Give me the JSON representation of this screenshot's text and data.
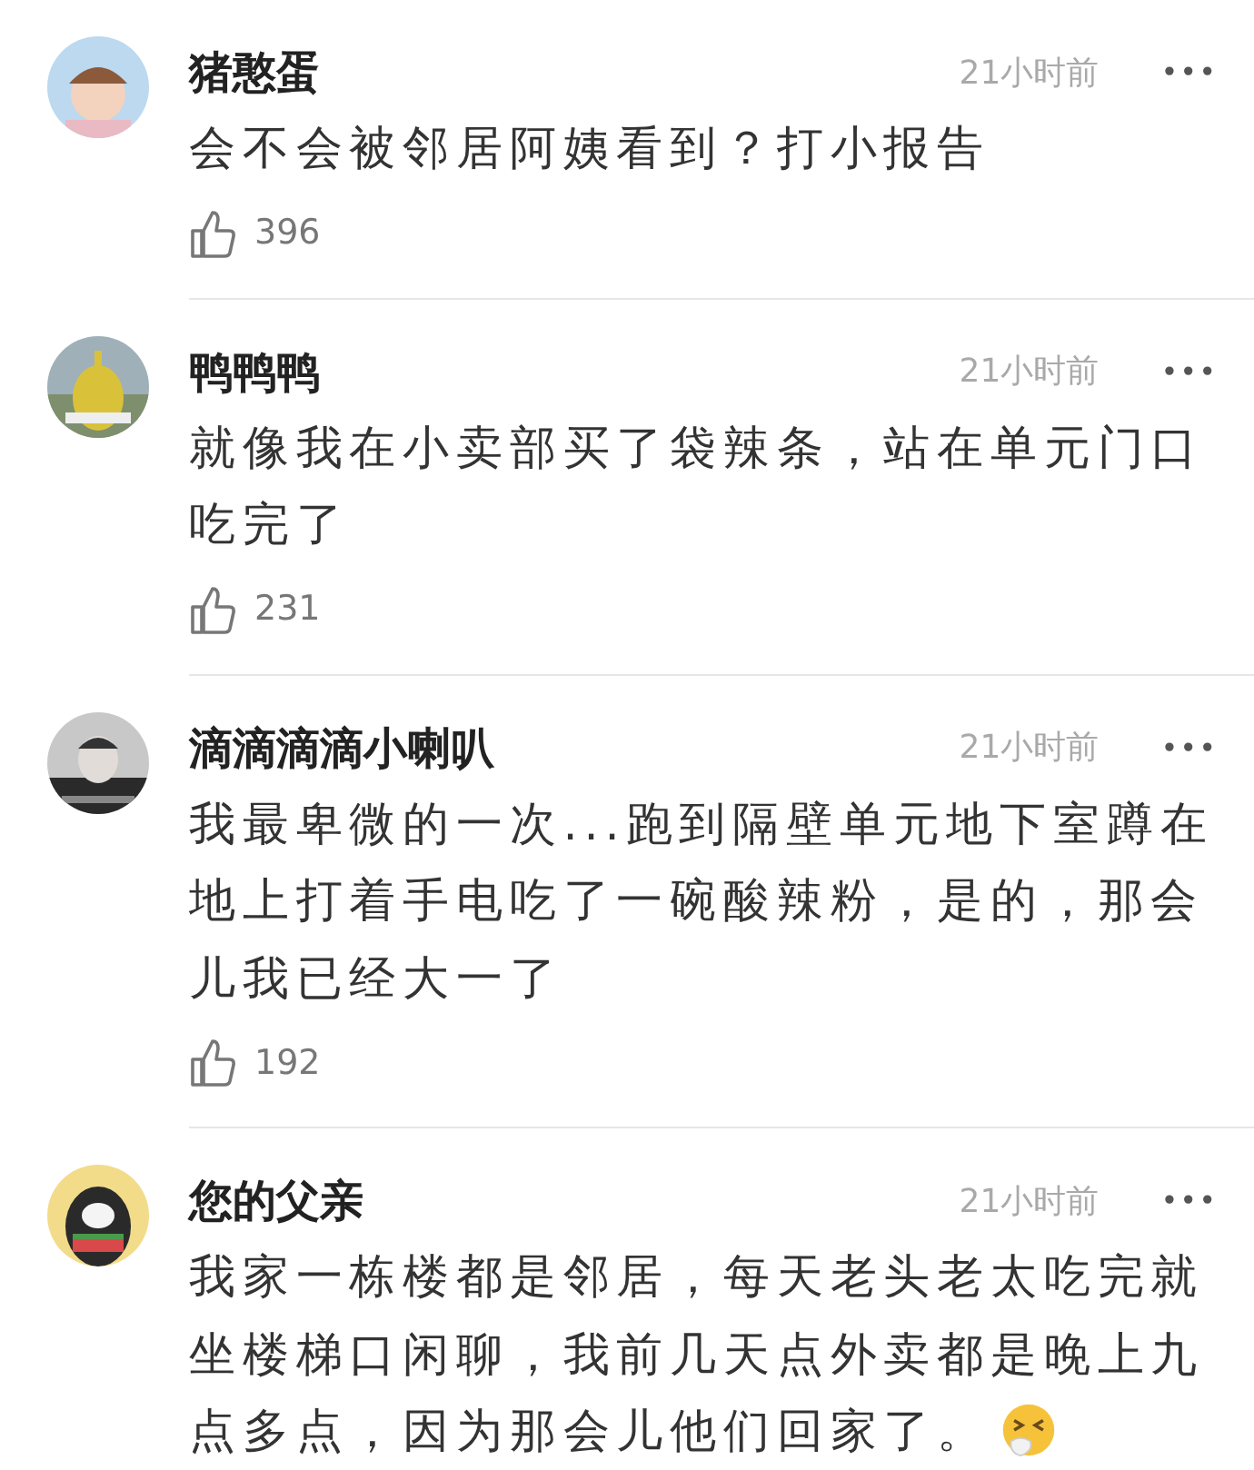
{
  "comments": [
    {
      "user": "猪憨蛋",
      "time": "21小时前",
      "more": "•••",
      "text": "会不会被邻居阿姨看到？打小报告",
      "likes": "396"
    },
    {
      "user": "鸭鸭鸭",
      "time": "21小时前",
      "more": "•••",
      "text": "就像我在小卖部买了袋辣条，站在单元门口吃完了",
      "likes": "231"
    },
    {
      "user": "滴滴滴滴小喇叭",
      "time": "21小时前",
      "more": "•••",
      "text": "我最卑微的一次...跑到隔壁单元地下室蹲在地上打着手电吃了一碗酸辣粉，是的，那会儿我已经大一了",
      "likes": "192"
    },
    {
      "user": "您的父亲",
      "time": "21小时前",
      "more": "•••",
      "text": "我家一栋楼都是邻居，每天老头老太吃完就坐楼梯口闲聊，我前几天点外卖都是晚上九点多点，因为那会儿他们回家了。",
      "emoji_icon": true
    }
  ]
}
